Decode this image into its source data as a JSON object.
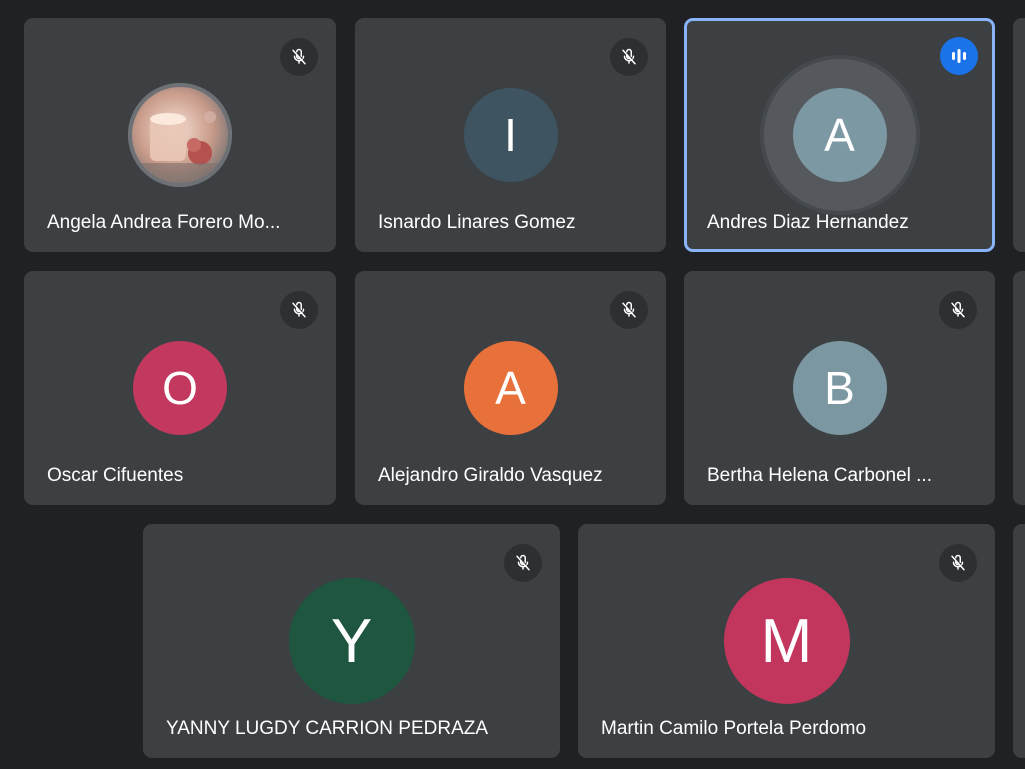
{
  "participants": [
    {
      "name": "Angela Andrea Forero Mo...",
      "initial": "",
      "avatar_type": "photo",
      "avatar_color": "#b9a49a",
      "muted": true,
      "speaking": false
    },
    {
      "name": "Isnardo Linares Gomez",
      "initial": "I",
      "avatar_type": "letter",
      "avatar_color": "#3e5461",
      "muted": true,
      "speaking": false
    },
    {
      "name": "Andres Diaz Hernandez",
      "initial": "A",
      "avatar_type": "letter",
      "avatar_color": "#7b98a3",
      "muted": false,
      "speaking": true
    },
    {
      "name": "Oscar Cifuentes",
      "initial": "O",
      "avatar_type": "letter",
      "avatar_color": "#c2385e",
      "muted": true,
      "speaking": false
    },
    {
      "name": "Alejandro Giraldo Vasquez",
      "initial": "A",
      "avatar_type": "letter",
      "avatar_color": "#e8703a",
      "muted": true,
      "speaking": false
    },
    {
      "name": "Bertha Helena Carbonel ...",
      "initial": "B",
      "avatar_type": "letter",
      "avatar_color": "#7b97a2",
      "muted": true,
      "speaking": false
    },
    {
      "name": "YANNY LUGDY CARRION PEDRAZA",
      "initial": "Y",
      "avatar_type": "letter",
      "avatar_color": "#1e5640",
      "muted": true,
      "speaking": false
    },
    {
      "name": "Martin Camilo Portela Perdomo",
      "initial": "M",
      "avatar_type": "letter",
      "avatar_color": "#c2365e",
      "muted": true,
      "speaking": false
    }
  ],
  "icons": {
    "muted": "mic-off-icon",
    "speaking": "audio-level-icon",
    "photo": "candle-photo"
  },
  "colors": {
    "background": "#202124",
    "tile": "#3c4043",
    "active_border": "#8ab4f8",
    "speaking_badge": "#1a73e8"
  }
}
